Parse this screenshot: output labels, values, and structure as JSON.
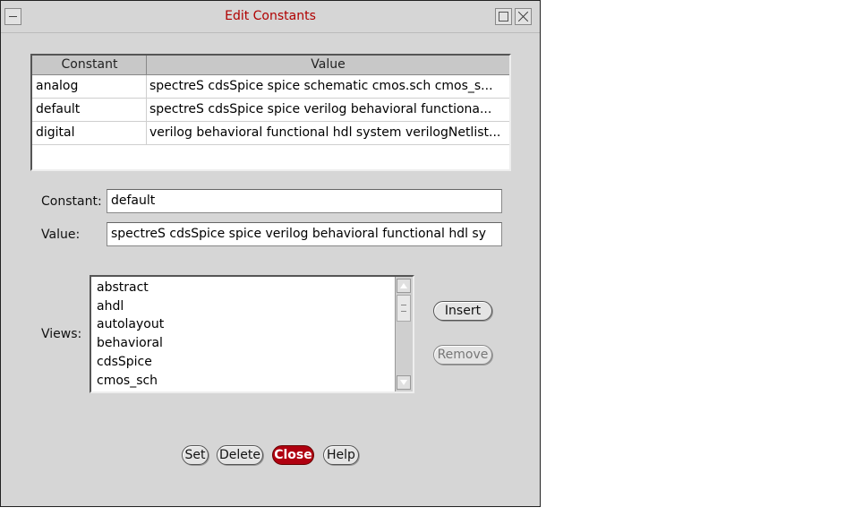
{
  "window": {
    "title": "Edit Constants"
  },
  "table": {
    "columns": [
      "Constant",
      "Value"
    ],
    "rows": [
      {
        "constant": "analog",
        "value": "spectreS cdsSpice spice schematic cmos.sch cmos_s..."
      },
      {
        "constant": "default",
        "value": "spectreS cdsSpice spice verilog behavioral functiona..."
      },
      {
        "constant": "digital",
        "value": "verilog behavioral functional hdl system verilogNetlist..."
      }
    ]
  },
  "form": {
    "constant_label": "Constant:",
    "constant_value": "default",
    "value_label": "Value:",
    "value_value": "spectreS cdsSpice spice verilog behavioral functional hdl sy",
    "views_label": "Views:"
  },
  "views": [
    "abstract",
    "ahdl",
    "autolayout",
    "behavioral",
    "cdsSpice",
    "cmos_sch"
  ],
  "side_buttons": {
    "insert": "Insert",
    "remove": "Remove"
  },
  "bottom_buttons": {
    "set": "Set",
    "delete": "Delete",
    "close": "Close",
    "help": "Help"
  },
  "colors": {
    "title": "#b00000",
    "close_button": "#b00010",
    "window_bg": "#d6d6d6"
  }
}
